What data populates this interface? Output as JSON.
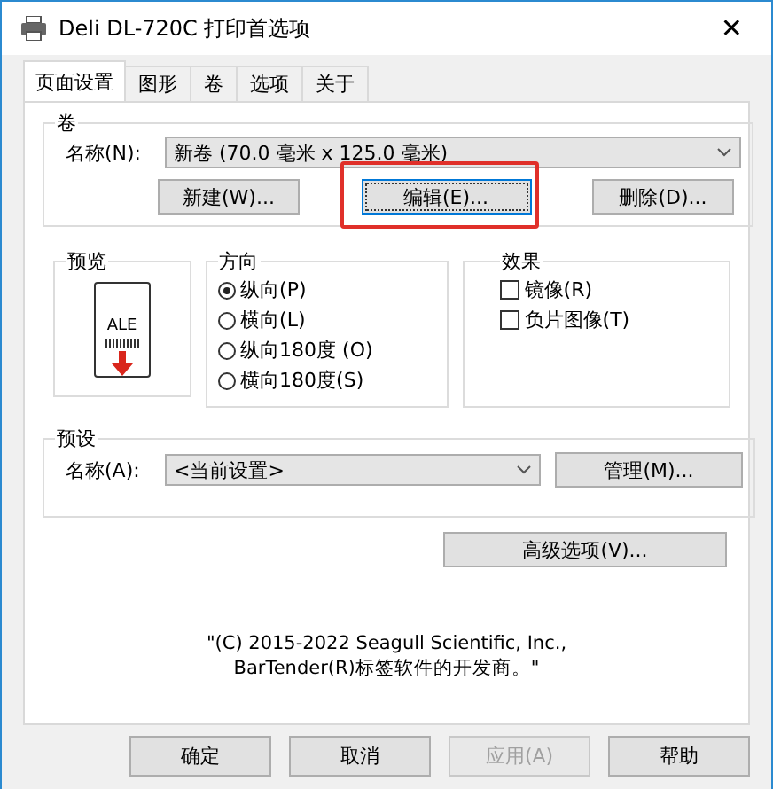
{
  "window": {
    "title": "Deli DL-720C 打印首选项",
    "close": "✕"
  },
  "tabs": [
    {
      "label": "页面设置",
      "selected": true
    },
    {
      "label": "图形",
      "selected": false
    },
    {
      "label": "卷",
      "selected": false
    },
    {
      "label": "选项",
      "selected": false
    },
    {
      "label": "关于",
      "selected": false
    }
  ],
  "roll": {
    "legend": "卷",
    "name_label": "名称(N):",
    "name_value": "新卷 (70.0 毫米 x 125.0 毫米)",
    "buttons": [
      {
        "label": "新建(W)...",
        "highlighted": false
      },
      {
        "label": "编辑(E)...",
        "highlighted": true
      },
      {
        "label": "删除(D)...",
        "highlighted": false
      }
    ]
  },
  "preview": {
    "legend": "预览",
    "label_text": "ALE"
  },
  "orientation": {
    "legend": "方向",
    "options": [
      {
        "label": "纵向(P)",
        "selected": true
      },
      {
        "label": "横向(L)",
        "selected": false
      },
      {
        "label": "纵向180度 (O)",
        "selected": false
      },
      {
        "label": "横向180度(S)",
        "selected": false
      }
    ]
  },
  "effects": {
    "legend": "效果",
    "options": [
      {
        "label": "镜像(R)",
        "checked": false
      },
      {
        "label": "负片图像(T)",
        "checked": false
      }
    ]
  },
  "preset": {
    "legend": "预设",
    "name_label": "名称(A):",
    "name_value": "<当前设置>",
    "manage": "管理(M)..."
  },
  "advanced": "高级选项(V)...",
  "copyright": [
    "\"(C) 2015-2022 Seagull Scientific, Inc.,",
    "BarTender(R)标签软件的开发商。\""
  ],
  "buttons": [
    {
      "label": "确定",
      "disabled": false
    },
    {
      "label": "取消",
      "disabled": false
    },
    {
      "label": "应用(A)",
      "disabled": true
    },
    {
      "label": "帮助",
      "disabled": false
    }
  ]
}
